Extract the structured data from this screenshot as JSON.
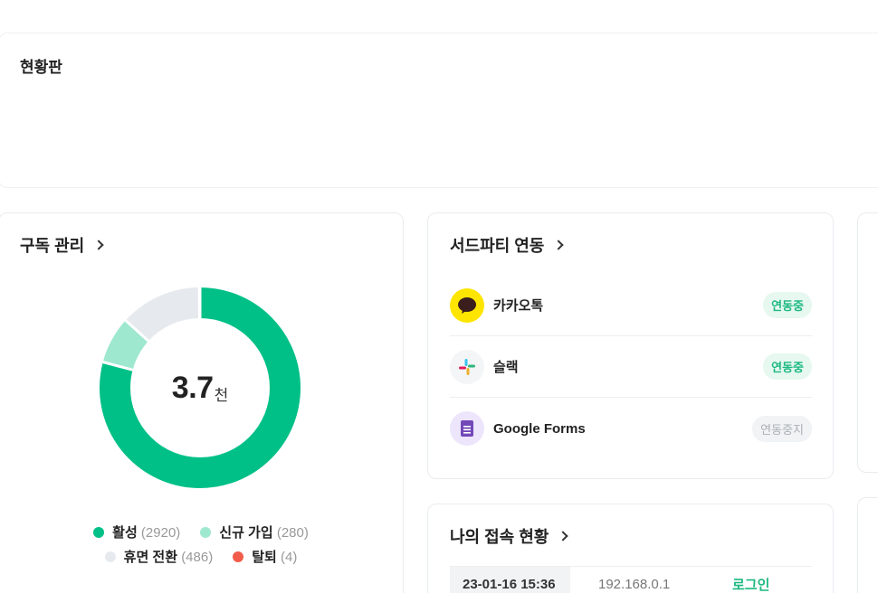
{
  "dashboard": {
    "title": "현황판"
  },
  "subscription": {
    "title": "구독 관리",
    "center_value": "3.7",
    "center_unit": "천",
    "legend": [
      {
        "label": "활성",
        "count": "(2920)",
        "color": "#00c087"
      },
      {
        "label": "신규 가입",
        "count": "(280)",
        "color": "#9ee8cf"
      },
      {
        "label": "휴면 전환",
        "count": "(486)",
        "color": "#e6eaee"
      },
      {
        "label": "탈퇴",
        "count": "(4)",
        "color": "#f25c4a"
      }
    ]
  },
  "chart_data": {
    "type": "pie",
    "categories": [
      "활성",
      "신규 가입",
      "휴면 전환",
      "탈퇴"
    ],
    "values": [
      2920,
      280,
      486,
      4
    ],
    "colors": [
      "#00c087",
      "#9ee8cf",
      "#e6eaee",
      "#f25c4a"
    ]
  },
  "third_party": {
    "title": "서드파티 연동",
    "items": [
      {
        "name": "카카오톡",
        "status": "연동중",
        "active": true
      },
      {
        "name": "슬랙",
        "status": "연동중",
        "active": true
      },
      {
        "name": "Google Forms",
        "status": "연동중지",
        "active": false
      }
    ]
  },
  "access": {
    "title": "나의 접속 현황",
    "rows": [
      {
        "time": "23-01-16 15:36",
        "ip": "192.168.0.1",
        "action": "로그인"
      }
    ]
  }
}
